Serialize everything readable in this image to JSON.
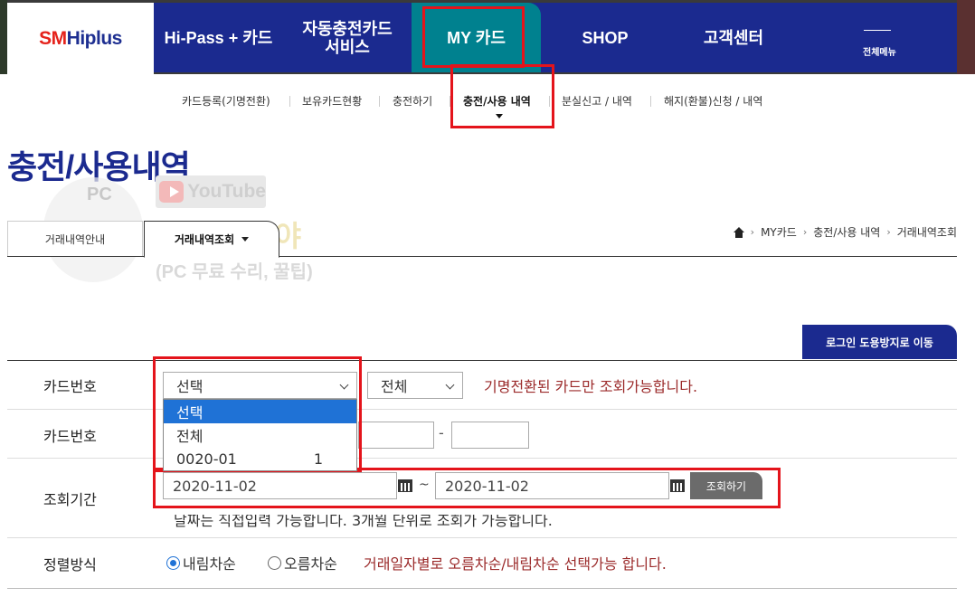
{
  "logo": {
    "part1": "SM",
    "part2": "Hiplus"
  },
  "nav": {
    "items": [
      "Hi-Pass + 카드",
      "자동충전카드",
      "서비스",
      "MY 카드",
      "SHOP",
      "고객센터"
    ],
    "all_menu": "전체메뉴"
  },
  "subnav": [
    "카드등록(기명전환)",
    "보유카드현황",
    "충전하기",
    "충전/사용 내역",
    "분실신고 / 내역",
    "해지(환불)신청 / 내역"
  ],
  "page_title": "충전/사용내역",
  "watermark": {
    "pc": "PC",
    "youtube": "YouTube",
    "main": "배나 수리야",
    "sub": "(PC 무료 수리, 꿀팁)"
  },
  "tabs": [
    "거래내역안내",
    "거래내역조회"
  ],
  "breadcrumb": [
    "MY카드",
    "충전/사용 내역",
    "거래내역조회"
  ],
  "login_button": "로그인 도용방지로 이동",
  "form": {
    "card_label_1": "카드번호",
    "card_select_value": "선택",
    "type_select_value": "전체",
    "card_note": "기명전환된 카드만 조회가능합니다.",
    "dropdown_options": [
      "선택",
      "전체",
      "0020-01",
      "1"
    ],
    "card_label_2": "카드번호",
    "dash": "-",
    "period_label": "조회기간",
    "date_from": "2020-11-02",
    "tilde": "~",
    "date_to": "2020-11-02",
    "search_button": "조회하기",
    "period_hint": "날짜는 직접입력 가능합니다. 3개월 단위로 조회가 가능합니다.",
    "sort_label": "정렬방식",
    "sort_desc": "내림차순",
    "sort_asc": "오름차순",
    "sort_note": "거래일자별로 오름차순/내림차순 선택가능 합니다."
  }
}
